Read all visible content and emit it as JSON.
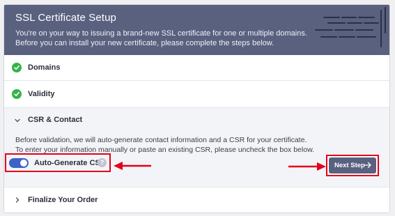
{
  "header": {
    "title": "SSL Certificate Setup",
    "desc_line1": "You're on your way to issuing a brand-new SSL certificate for one or multiple domains.",
    "desc_line2": "Before you can install your new certificate, please complete the steps below."
  },
  "steps": {
    "domains": {
      "label": "Domains",
      "status": "complete"
    },
    "validity": {
      "label": "Validity",
      "status": "complete"
    },
    "csr": {
      "label": "CSR & Contact",
      "text_line1": "Before validation, we will auto-generate contact information and a CSR for your certificate.",
      "text_line2": "To enter your information manually or paste an existing CSR, please uncheck the box below.",
      "toggle_label": "Auto-Generate CSR",
      "toggle_on": true,
      "help_glyph": "?",
      "next_button": "Next Step"
    },
    "finalize": {
      "label": "Finalize Your Order"
    }
  },
  "colors": {
    "header_bg": "#59617f",
    "check_green": "#36b24b",
    "toggle_blue": "#3d63c7",
    "highlight_red": "#e3001b"
  },
  "icons": [
    "check-icon",
    "chevron-down-icon",
    "chevron-right-icon",
    "help-icon",
    "arrow-right-icon"
  ]
}
